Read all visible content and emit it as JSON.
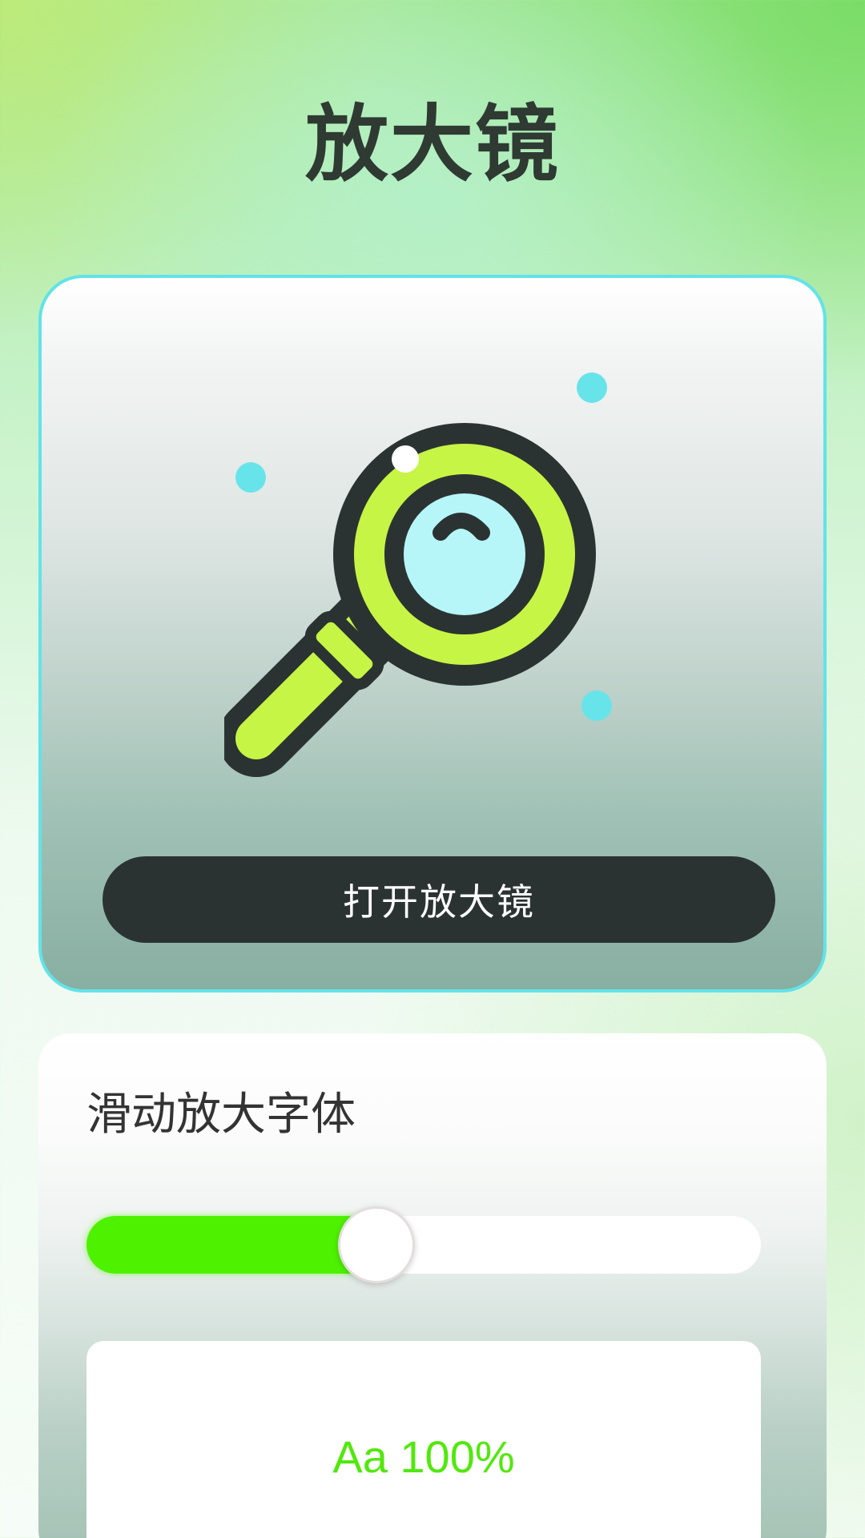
{
  "header": {
    "title": "放大镜"
  },
  "magnifier_card": {
    "icon": "magnifying-glass-icon",
    "open_button_label": "打开放大镜"
  },
  "font_card": {
    "title": "滑动放大字体",
    "slider": {
      "value_percent": 100,
      "fill_fraction": 0.43
    },
    "preview_text": "Aa 100%"
  },
  "colors": {
    "card_border": "#62e3e8",
    "button_bg": "#2b3332",
    "slider_fill": "#4ef200",
    "preview_text": "#52e80d",
    "icon_lime": "#c6f545",
    "icon_lens": "#b6f6f9",
    "icon_outline": "#2b3332"
  }
}
